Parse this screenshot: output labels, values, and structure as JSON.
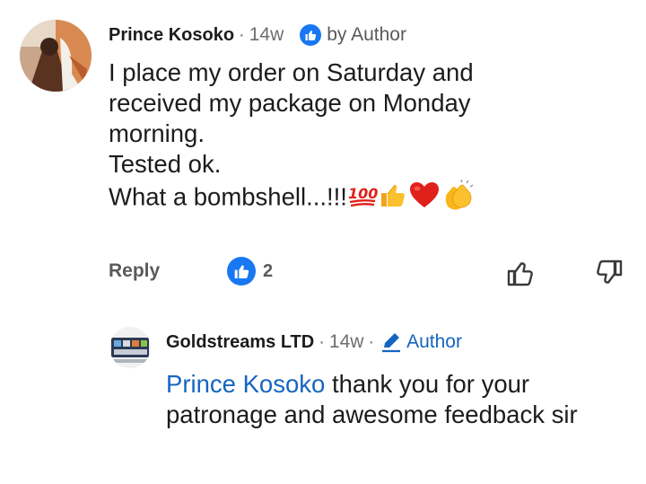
{
  "comment": {
    "author": "Prince Kosoko",
    "separator": "·",
    "age": "14w",
    "liked_by_author_label": "by Author",
    "text_lines": [
      "I place my order on Saturday and",
      "received my package on Monday",
      "morning.",
      "Tested ok.",
      "What a bombshell...!!!"
    ],
    "emojis": [
      "hundred-points",
      "thumbs-up",
      "red-heart",
      "clapping-hands"
    ],
    "actions": {
      "reply_label": "Reply",
      "like_count": "2"
    }
  },
  "reply": {
    "author": "Goldstreams LTD",
    "separator": "·",
    "age": "14w",
    "separator2": "·",
    "author_badge_label": "Author",
    "mention": "Prince Kosoko",
    "text": " thank you for your patronage and awesome feedback sir"
  },
  "colors": {
    "accent_blue": "#1565c0",
    "like_badge_blue": "#1877f2",
    "secondary_text": "#6e6e6e",
    "heart_red": "#e0201b",
    "emoji_yellow": "#f9b51a"
  }
}
